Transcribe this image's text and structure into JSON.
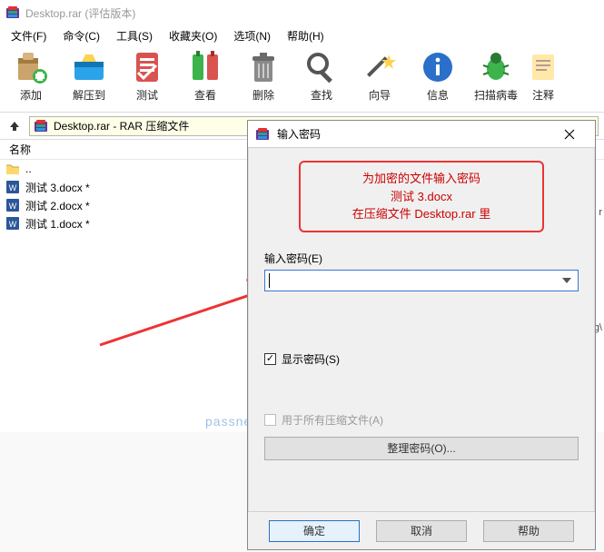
{
  "titlebar": {
    "title": "Desktop.rar (评估版本)"
  },
  "menus": {
    "file": "文件(F)",
    "cmd": "命令(C)",
    "tools": "工具(S)",
    "fav": "收藏夹(O)",
    "opts": "选项(N)",
    "help": "帮助(H)"
  },
  "toolbar": {
    "add": "添加",
    "extract": "解压到",
    "test": "测试",
    "view": "查看",
    "delete": "删除",
    "find": "查找",
    "wizard": "向导",
    "info": "信息",
    "virus": "扫描病毒",
    "comment": "注释"
  },
  "addr": {
    "text": "Desktop.rar - RAR 压缩文件"
  },
  "columns": {
    "name": "名称"
  },
  "files": {
    "up": "..",
    "items": [
      {
        "name": "测试 3.docx *"
      },
      {
        "name": "测试 2.docx *"
      },
      {
        "name": "测试 1.docx *"
      }
    ]
  },
  "watermark": "passneo.cn",
  "dialog": {
    "title": "输入密码",
    "hint_line1": "为加密的文件输入密码",
    "hint_line2": "测试 3.docx",
    "hint_line3": "在压缩文件 Desktop.rar 里",
    "field_label": "输入密码(E)",
    "show_pwd": "显示密码(S)",
    "apply_all": "用于所有压缩文件(A)",
    "organize": "整理密码(O)...",
    "ok": "确定",
    "cancel": "取消",
    "help": "帮助"
  },
  "right_fragments": {
    "r1": "g\\"
  }
}
